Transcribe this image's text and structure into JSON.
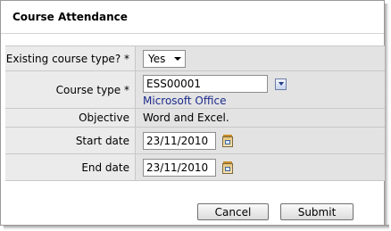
{
  "dialog": {
    "title": "Course Attendance"
  },
  "form": {
    "existing_course_type": {
      "label": "Existing course type? *",
      "value": "Yes"
    },
    "course_type": {
      "label": "Course type *",
      "value": "ESS00001",
      "link_text": "Microsoft Office"
    },
    "objective": {
      "label": "Objective",
      "value": "Word and Excel."
    },
    "start_date": {
      "label": "Start date",
      "value": "23/11/2010"
    },
    "end_date": {
      "label": "End date",
      "value": "23/11/2010"
    }
  },
  "buttons": {
    "cancel": "Cancel",
    "submit": "Submit"
  },
  "icons": {
    "browse": "dropdown-browse-icon",
    "calendar": "calendar-icon"
  },
  "colors": {
    "label_bg": "#ebebeb",
    "value_bg": "#e3e3e3",
    "link": "#1d2b8c"
  }
}
